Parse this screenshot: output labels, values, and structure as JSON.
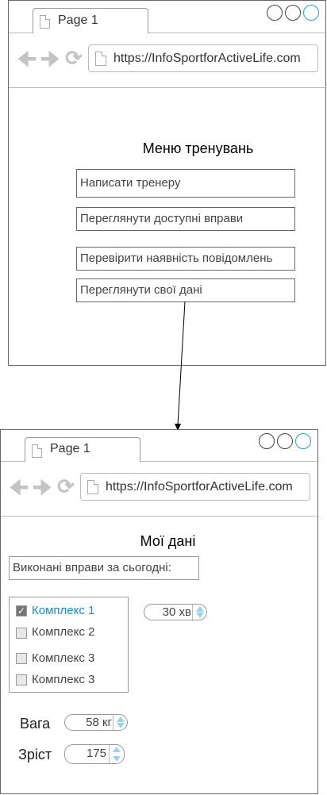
{
  "screen1": {
    "tab_title": "Page 1",
    "url": "https://InfoSportforActiveLife.com",
    "title": "Меню тренувань",
    "buttons": [
      "Написати тренеру",
      "Переглянути доступні вправи",
      "Перевірити наявність повідомлень",
      "Переглянути свої дані"
    ]
  },
  "screen2": {
    "tab_title": "Page 1",
    "url": "https://InfoSportforActiveLife.com",
    "title": "Мої дані",
    "exercises_label": "Виконані вправи за сьогодні:",
    "complexes": [
      {
        "label": "Комплекс 1",
        "checked": true
      },
      {
        "label": "Комплекс 2",
        "checked": false
      },
      {
        "label": "Комплекс 3",
        "checked": false
      },
      {
        "label": "Комплекс 3",
        "checked": false
      }
    ],
    "duration": "30 хв",
    "weight_label": "Вага",
    "weight_value": "58 кг",
    "height_label": "Зріст",
    "height_value": "175"
  },
  "colors": {
    "accent": "#2a9fd0",
    "checked_text": "#1a8fc7",
    "spinner_arrow": "#9cd2ee"
  },
  "icons": [
    "back-arrow-icon",
    "forward-arrow-icon",
    "reload-icon",
    "page-icon",
    "checkmark-icon"
  ]
}
